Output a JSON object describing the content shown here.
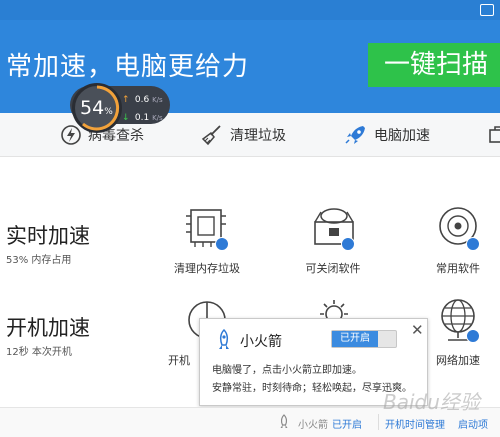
{
  "header": {
    "slogan": "常加速，电脑更给力",
    "scan_button": "一键扫描"
  },
  "meter": {
    "percent": "54",
    "percent_unit": "%",
    "upload_speed": "0.6",
    "download_speed": "0.1",
    "speed_unit": "K/s"
  },
  "tabs": [
    {
      "label": ""
    },
    {
      "label": "病毒查杀"
    },
    {
      "label": "清理垃圾"
    },
    {
      "label": "电脑加速"
    },
    {
      "label": ""
    }
  ],
  "realtime": {
    "title": "实时加速",
    "subtitle": "53% 内存占用",
    "tools": [
      {
        "label": "清理内存垃圾",
        "icon": "memory-chip-icon"
      },
      {
        "label": "可关闭软件",
        "icon": "software-box-icon"
      },
      {
        "label": "常用软件",
        "icon": "disc-icon"
      }
    ]
  },
  "boot": {
    "title": "开机加速",
    "subtitle": "12秒 本次开机",
    "tools": [
      {
        "label": "开机",
        "icon": "power-icon"
      },
      {
        "label": "",
        "icon": "gear-icon"
      },
      {
        "label": "网络加速",
        "icon": "globe-icon"
      }
    ]
  },
  "popup": {
    "title": "小火箭",
    "toggle_label": "已开启",
    "close": "✕",
    "line1": "电脑慢了，点击小火箭立即加速。",
    "line2": "安静常驻，时刻待命；轻松唤起，尽享迅爽。"
  },
  "footer": {
    "rocket_label": "小火箭",
    "rocket_status": "已开启",
    "boot_time_manage": "开机时间管理",
    "startup_items": "启动项"
  },
  "watermark": "Baidu经验",
  "colors": {
    "header_blue": "#2e86dc",
    "scan_green": "#2ec24a",
    "accent_blue": "#2e7ad6"
  }
}
